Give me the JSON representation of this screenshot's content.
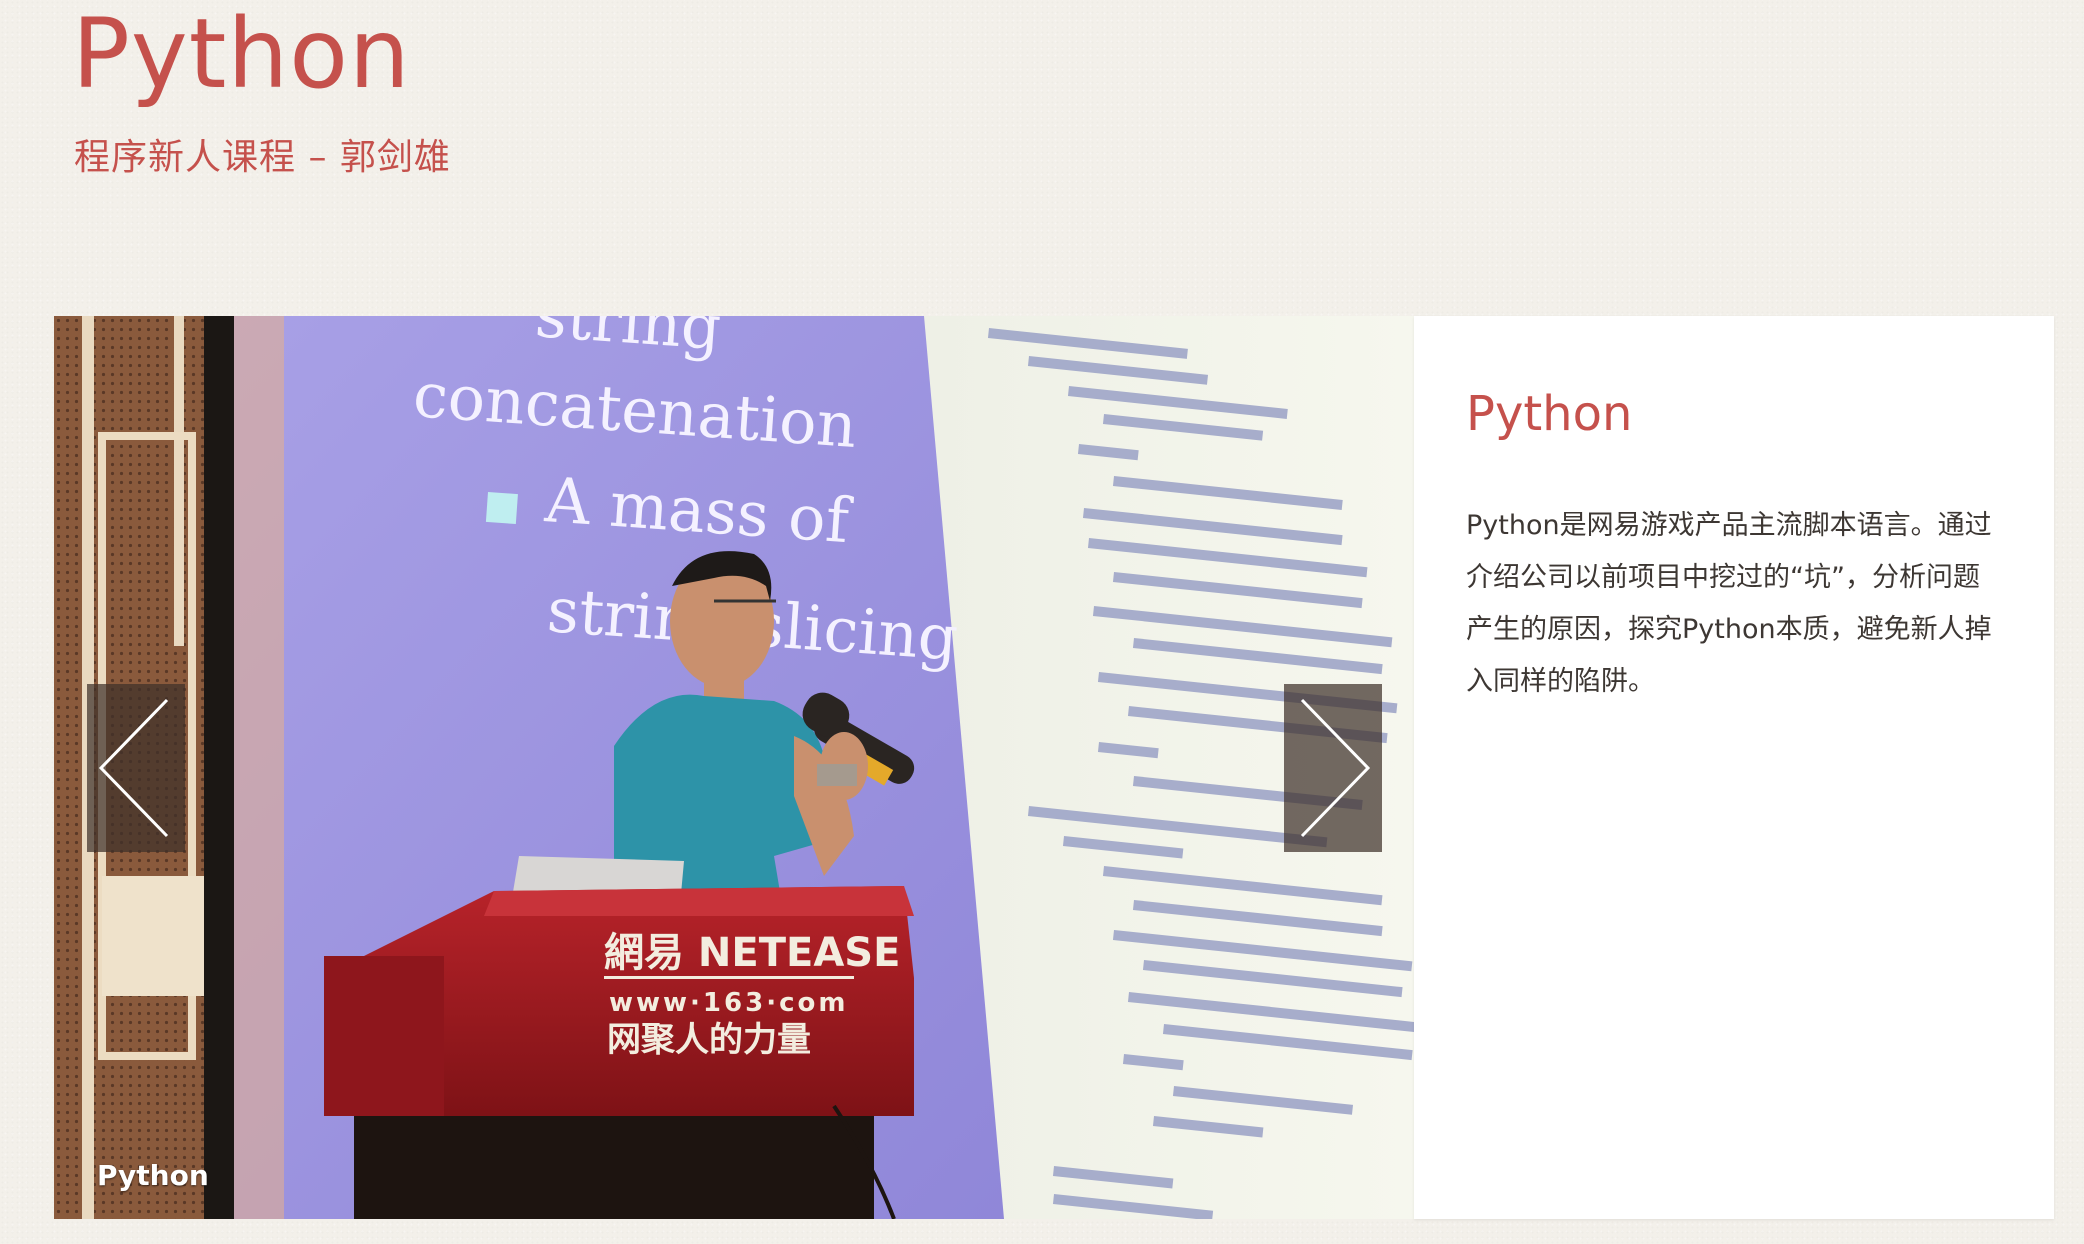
{
  "header": {
    "title": "Python",
    "subtitle": "程序新人课程 – 郭剑雄"
  },
  "carousel": {
    "caption": "Python",
    "prev_label": "Previous",
    "next_label": "Next",
    "prev_icon": "chevron-left-icon",
    "next_icon": "chevron-right-icon",
    "slide_text": {
      "slide_line1": "string",
      "slide_line2": "concatenation",
      "slide_line3": "A mass of",
      "slide_line4": "string slicing",
      "podium_brand": "網易 NETEASE",
      "podium_url": "www·163·com",
      "podium_slogan": "网聚人的力量"
    }
  },
  "info": {
    "title": "Python",
    "description": "Python是网易游戏产品主流脚本语言。通过介绍公司以前项目中挖过的“坑”，分析问题产生的原因，探究Python本质，避免新人掉入同样的陷阱。"
  },
  "colors": {
    "accent": "#c5514c",
    "background": "#f3f0ea",
    "panel": "#ffffff",
    "body_text": "#3d3733"
  }
}
